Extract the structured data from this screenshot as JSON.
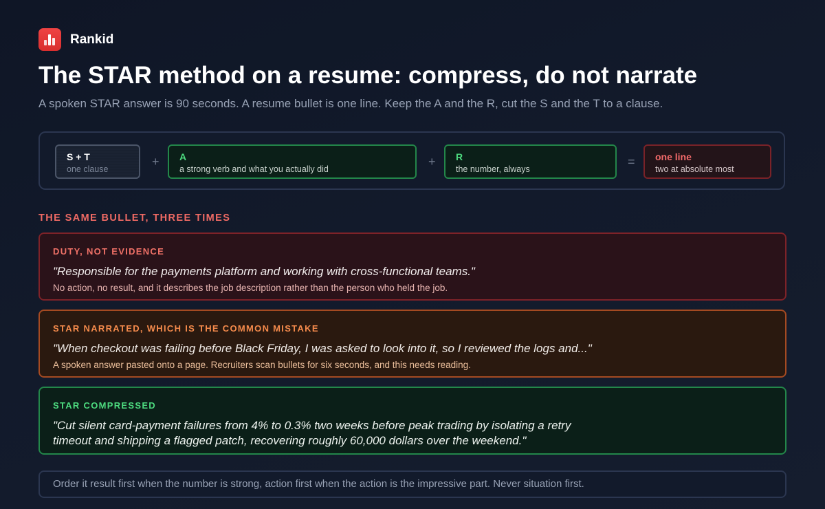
{
  "brand": {
    "name": "Rankid",
    "logo_icon": "bar-chart-logo-icon",
    "accent": "#e53935"
  },
  "header": {
    "title": "The STAR method on a resume: compress, do not narrate",
    "subtitle": "A spoken STAR answer is 90 seconds. A resume bullet is one line. Keep the A and the R, cut the S and the T to a clause."
  },
  "formula": {
    "terms": [
      {
        "title": "S + T",
        "sub": "one clause"
      },
      {
        "title": "A",
        "sub": "a strong verb and what you actually did"
      },
      {
        "title": "R",
        "sub": "the number, always"
      },
      {
        "title": "one line",
        "sub": "two at absolute most"
      }
    ],
    "operators": [
      "+",
      "+",
      "="
    ]
  },
  "examples_section": {
    "label": "THE SAME BULLET, THREE TIMES",
    "items": [
      {
        "label": "DUTY, NOT EVIDENCE",
        "quote": "\"Responsible for the payments platform and working with cross-functional teams.\"",
        "note": "No action, no result, and it describes the job description rather than the person who held the job.",
        "color": "#f07167"
      },
      {
        "label": "STAR NARRATED, WHICH IS THE COMMON MISTAKE",
        "quote": "\"When checkout was failing before Black Friday, I was asked to look into it, so I reviewed the logs and...\"",
        "note": "A spoken answer pasted onto a page. Recruiters scan bullets for six seconds, and this needs reading.",
        "color": "#f58b4c"
      },
      {
        "label": "STAR COMPRESSED",
        "quote_line1": "\"Cut silent card-payment failures from 4% to 0.3% two weeks before peak trading by isolating a retry",
        "quote_line2": "timeout and shipping a flagged patch, recovering roughly 60,000 dollars over the weekend.\"",
        "color": "#4ddb7f"
      }
    ]
  },
  "tip": {
    "text": "Order it result first when the number is strong, action first when the action is the impressive part. Never situation first."
  }
}
